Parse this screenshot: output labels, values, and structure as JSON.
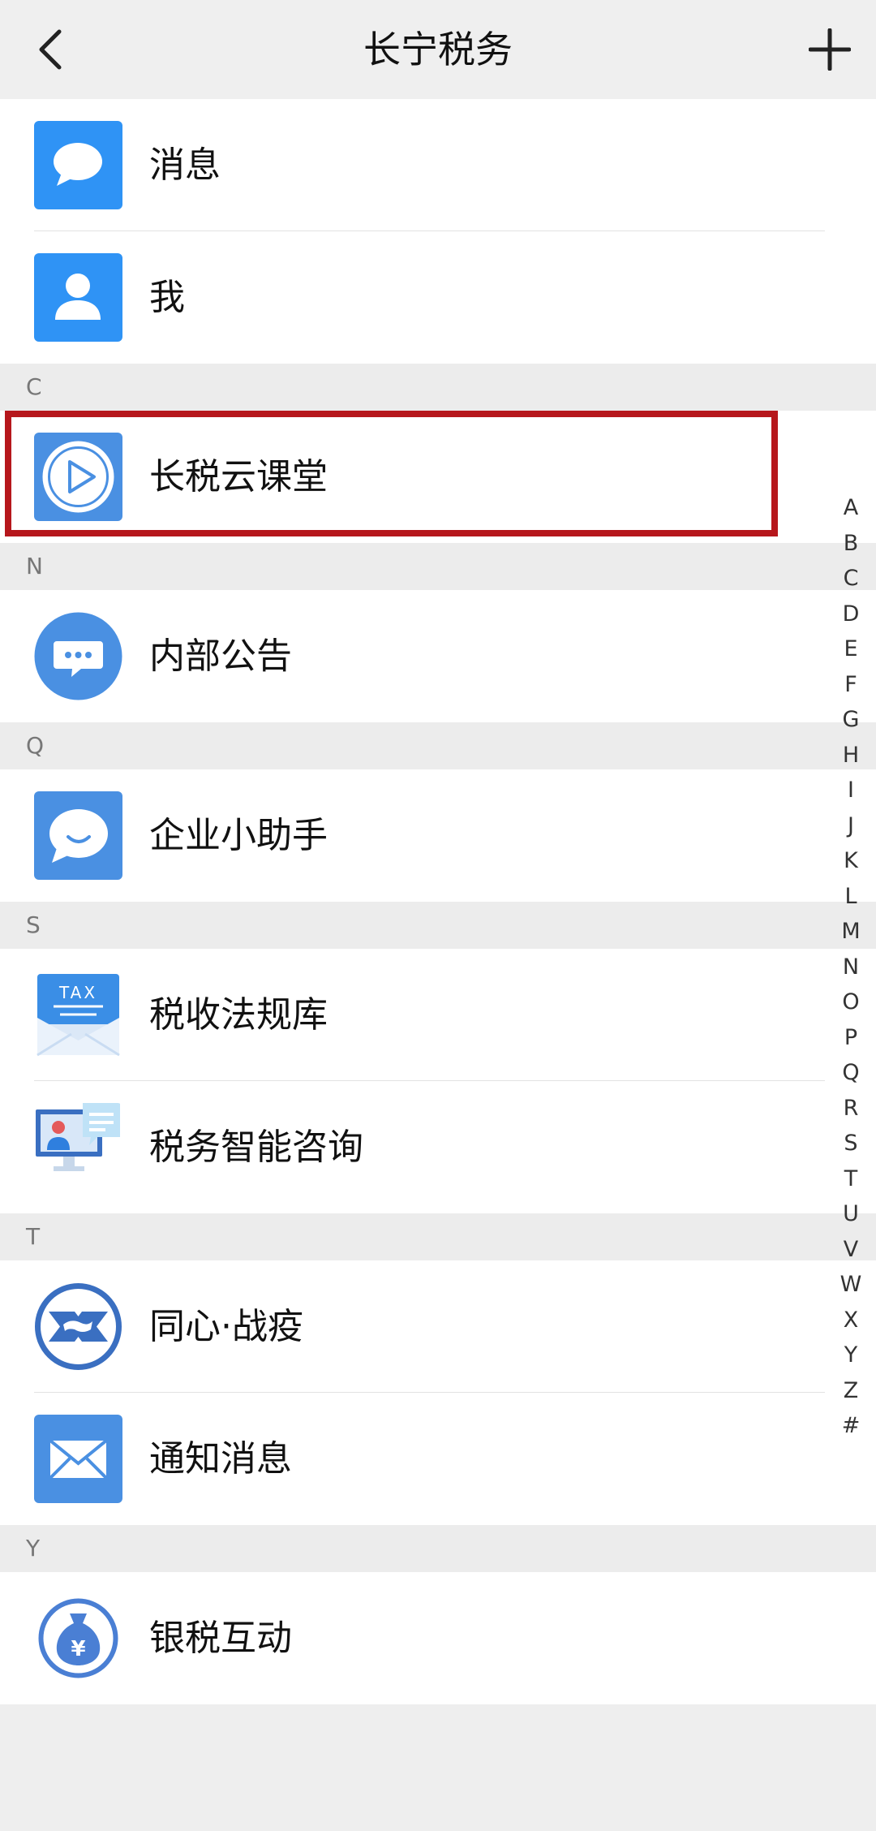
{
  "header": {
    "title": "长宁税务"
  },
  "top_items": [
    {
      "label": "消息",
      "icon": "chat-bubble-icon"
    },
    {
      "label": "我",
      "icon": "user-icon"
    }
  ],
  "sections": [
    {
      "letter": "C",
      "items": [
        {
          "label": "长税云课堂",
          "icon": "play-icon"
        }
      ]
    },
    {
      "letter": "N",
      "items": [
        {
          "label": "内部公告",
          "icon": "announcement-icon"
        }
      ]
    },
    {
      "letter": "Q",
      "items": [
        {
          "label": "企业小助手",
          "icon": "smile-chat-icon"
        }
      ]
    },
    {
      "letter": "S",
      "items": [
        {
          "label": "税收法规库",
          "icon": "tax-envelope-icon"
        },
        {
          "label": "税务智能咨询",
          "icon": "consultation-icon"
        }
      ]
    },
    {
      "letter": "T",
      "items": [
        {
          "label": "同心·战疫",
          "icon": "wuhan-emblem-icon"
        },
        {
          "label": "通知消息",
          "icon": "mail-icon"
        }
      ]
    },
    {
      "letter": "Y",
      "items": [
        {
          "label": "银税互动",
          "icon": "money-bag-icon"
        }
      ]
    }
  ],
  "alphabet_index": [
    "A",
    "B",
    "C",
    "D",
    "E",
    "F",
    "G",
    "H",
    "I",
    "J",
    "K",
    "L",
    "M",
    "N",
    "O",
    "P",
    "Q",
    "R",
    "S",
    "T",
    "U",
    "V",
    "W",
    "X",
    "Y",
    "Z",
    "#"
  ],
  "highlighted_item": "长税云课堂",
  "colors": {
    "highlight_border": "#b6171c",
    "icon_blue": "#3d8ff0",
    "icon_blue_soft": "#4a90e2"
  }
}
